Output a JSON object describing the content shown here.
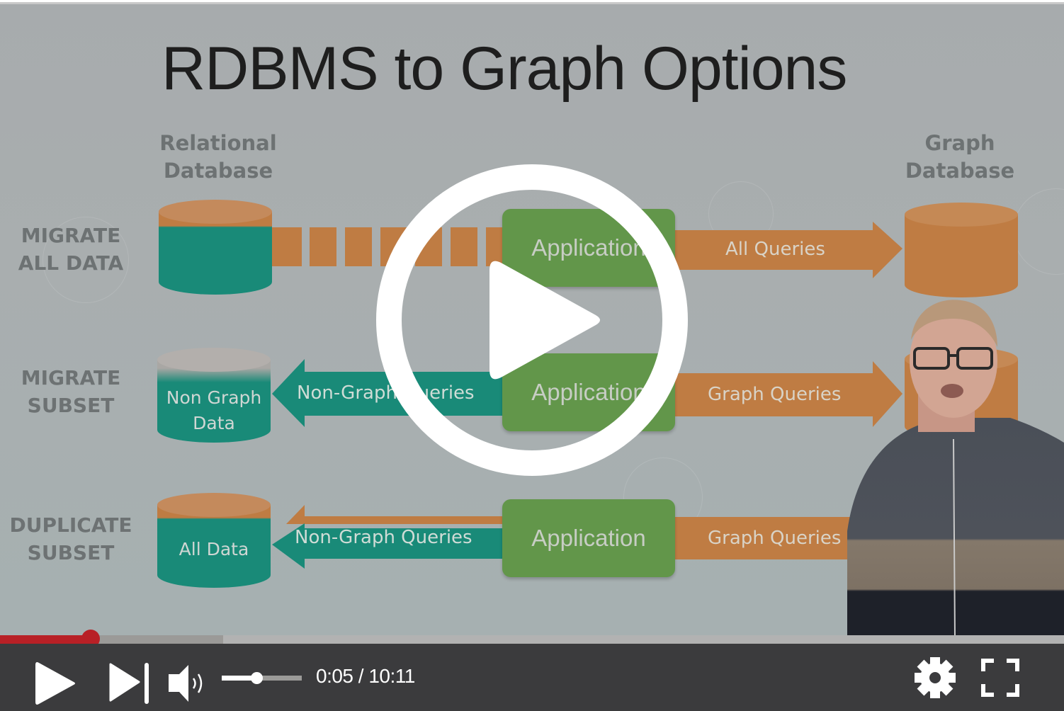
{
  "slide": {
    "title": "RDBMS to Graph Options",
    "columns": {
      "left_line1": "Relational",
      "left_line2": "Database",
      "right_line1": "Graph",
      "right_line2": "Database"
    },
    "rows": [
      {
        "label_line1": "MIGRATE",
        "label_line2": "ALL DATA",
        "db_text_line1": "",
        "db_text_line2": "",
        "left_arrow": "",
        "app": "Application",
        "right_arrow": "All Queries"
      },
      {
        "label_line1": "MIGRATE",
        "label_line2": "SUBSET",
        "db_text_line1": "Non Graph",
        "db_text_line2": "Data",
        "left_arrow": "Non-Graph Queries",
        "app": "Application",
        "right_arrow": "Graph Queries"
      },
      {
        "label_line1": "DUPLICATE",
        "label_line2": "SUBSET",
        "db_text_line1": "All Data",
        "db_text_line2": "",
        "left_arrow": "Non-Graph Queries",
        "app": "Application",
        "right_arrow": "Graph Queries"
      }
    ],
    "colors": {
      "orange": "#bf7c43",
      "teal": "#198a78",
      "green": "#62964a",
      "background": "#a8aeaf"
    }
  },
  "player": {
    "current_time": "0:05",
    "duration": "10:11",
    "time_display": "0:05 / 10:11",
    "played_fraction": 0.0085,
    "buffered_fraction": 0.21,
    "volume_fraction": 0.43,
    "is_playing": false,
    "accent_color": "#b82026",
    "icons": {
      "big_play": "play-circle-icon",
      "play": "play-icon",
      "next": "skip-next-icon",
      "volume": "volume-icon",
      "settings": "gear-icon",
      "fullscreen": "fullscreen-icon"
    }
  }
}
